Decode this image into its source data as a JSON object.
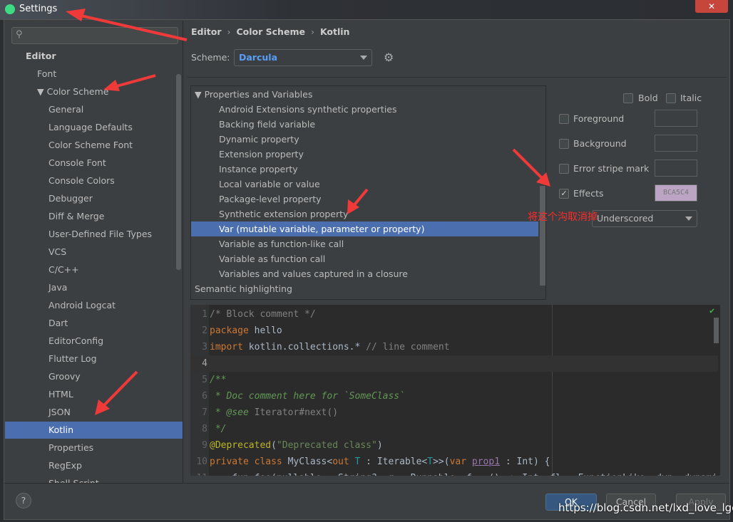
{
  "window": {
    "title": "Settings",
    "close": "✕"
  },
  "search": {
    "placeholder": "",
    "icon": "search-icon"
  },
  "sidebar": {
    "items": [
      {
        "label": "Editor",
        "level": 0,
        "header": true
      },
      {
        "label": "Font",
        "level": 1
      },
      {
        "label": "▼ Color Scheme",
        "level": 1
      },
      {
        "label": "General",
        "level": 2
      },
      {
        "label": "Language Defaults",
        "level": 2
      },
      {
        "label": "Color Scheme Font",
        "level": 2
      },
      {
        "label": "Console Font",
        "level": 2
      },
      {
        "label": "Console Colors",
        "level": 2
      },
      {
        "label": "Debugger",
        "level": 2
      },
      {
        "label": "Diff & Merge",
        "level": 2
      },
      {
        "label": "User-Defined File Types",
        "level": 2
      },
      {
        "label": "VCS",
        "level": 2
      },
      {
        "label": "C/C++",
        "level": 2
      },
      {
        "label": "Java",
        "level": 2
      },
      {
        "label": "Android Logcat",
        "level": 2
      },
      {
        "label": "Dart",
        "level": 2
      },
      {
        "label": "EditorConfig",
        "level": 2
      },
      {
        "label": "Flutter Log",
        "level": 2
      },
      {
        "label": "Groovy",
        "level": 2
      },
      {
        "label": "HTML",
        "level": 2
      },
      {
        "label": "JSON",
        "level": 2
      },
      {
        "label": "Kotlin",
        "level": 2,
        "selected": true
      },
      {
        "label": "Properties",
        "level": 2
      },
      {
        "label": "RegExp",
        "level": 2
      },
      {
        "label": "Shell Script",
        "level": 2
      }
    ]
  },
  "breadcrumb": [
    "Editor",
    "Color Scheme",
    "Kotlin"
  ],
  "scheme": {
    "label": "Scheme:",
    "value": "Darcula",
    "gear": "gear-icon"
  },
  "options": {
    "items": [
      {
        "label": "▼  Properties and Variables",
        "root": true
      },
      {
        "label": "Android Extensions synthetic properties"
      },
      {
        "label": "Backing field variable"
      },
      {
        "label": "Dynamic property"
      },
      {
        "label": "Extension property"
      },
      {
        "label": "Instance property"
      },
      {
        "label": "Local variable or value"
      },
      {
        "label": "Package-level property"
      },
      {
        "label": "Synthetic extension property"
      },
      {
        "label": "Var (mutable variable, parameter or property)",
        "selected": true
      },
      {
        "label": "Variable as function-like call"
      },
      {
        "label": "Variable as function call"
      },
      {
        "label": "Variables and values captured in a closure"
      },
      {
        "label": "Semantic highlighting",
        "root": true
      }
    ]
  },
  "attributes": {
    "bold": "Bold",
    "italic": "Italic",
    "foreground": "Foreground",
    "background": "Background",
    "error_stripe": "Error stripe mark",
    "effects": "Effects",
    "effects_checked": true,
    "effects_color": "BCA5C4",
    "effects_type": "Underscored"
  },
  "editor": {
    "lines": [
      [
        [
          "c",
          "/* Block comment */"
        ]
      ],
      [
        [
          "k",
          "package "
        ],
        [
          "id",
          "hello"
        ]
      ],
      [
        [
          "k",
          "import "
        ],
        [
          "id",
          "kotlin.collections.* "
        ],
        [
          "c",
          "// line comment"
        ]
      ],
      [],
      [
        [
          "d",
          "/**"
        ]
      ],
      [
        [
          "d",
          " * Doc comment here for `SomeClass`"
        ]
      ],
      [
        [
          "d",
          " * @see "
        ],
        [
          "c",
          "Iterator#next()"
        ]
      ],
      [
        [
          "d",
          " */"
        ]
      ],
      [
        [
          "a",
          "@Deprecated"
        ],
        [
          "id",
          "("
        ],
        [
          "s",
          "\"Deprecated class\""
        ],
        [
          "id",
          ")"
        ]
      ],
      [
        [
          "k",
          "private class "
        ],
        [
          "id",
          "MyClass<"
        ],
        [
          "k",
          "out "
        ],
        [
          "tp",
          "T"
        ],
        [
          "id",
          " : Iterable<"
        ],
        [
          "tp",
          "T"
        ],
        [
          "id",
          ">>("
        ],
        [
          "k",
          "var "
        ],
        [
          "pr",
          "prop1"
        ],
        [
          "id",
          " : Int) {"
        ]
      ],
      [
        [
          "id",
          "    fun foo(nullable : String?, r : Runnable, f : () -> Int, fl : FunctionLike, dyn: dynamic)"
        ]
      ]
    ]
  },
  "buttons": {
    "help": "?",
    "ok": "OK",
    "cancel": "Cancel",
    "apply": "Apply"
  },
  "annotation": "将这个沟取消掉",
  "watermark": "https://blog.csdn.net/lxd_love_lgc",
  "colors": {
    "selection": "#4b6eaf",
    "accent": "#589df6",
    "annotation": "#ff2a2a"
  }
}
